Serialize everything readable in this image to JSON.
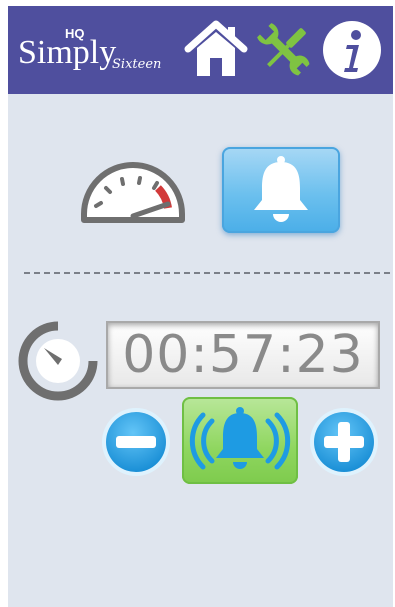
{
  "header": {
    "brand": {
      "hq": "HQ",
      "simply": "Simply",
      "sixteen": "Sixteen"
    },
    "nav": [
      {
        "name": "home-icon",
        "label": ""
      },
      {
        "name": "tools-icon",
        "label": ""
      },
      {
        "name": "info-icon",
        "label": ""
      }
    ]
  },
  "controls": {
    "speed_icon": "speedometer-icon",
    "alarm_icon": "bell-icon"
  },
  "timer": {
    "icon": "timer-icon",
    "value": "00:57:23",
    "minus_icon": "minus-icon",
    "plus_icon": "plus-icon",
    "alarm_toggle_icon": "ringing-bell-icon"
  },
  "colors": {
    "header_bg": "#4f4f9e",
    "app_bg": "#dfe5ee",
    "accent_blue": "#1e9be3",
    "accent_green": "#8fd65f",
    "tools_green": "#7fc342"
  }
}
